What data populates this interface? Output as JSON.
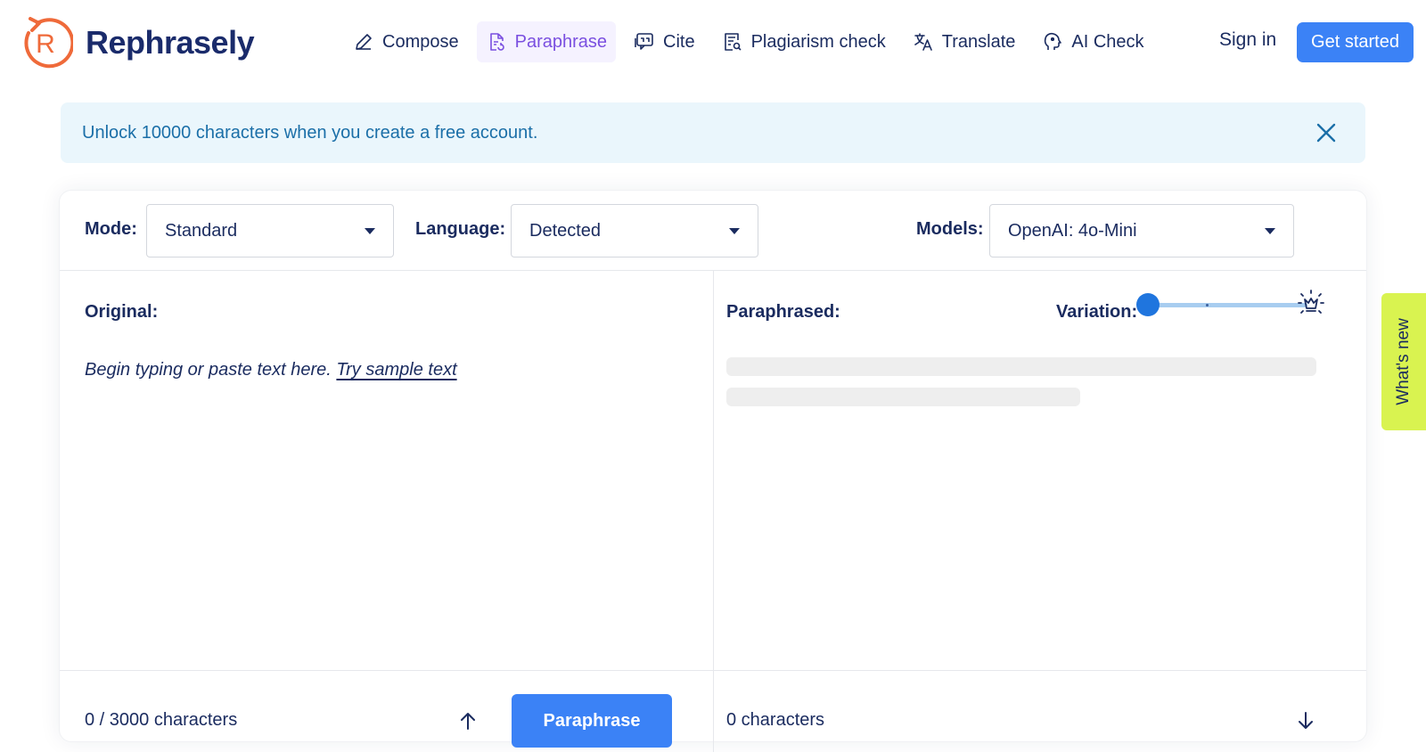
{
  "header": {
    "brand": "Rephrasely",
    "brand_color": "#ef6a3a",
    "nav": [
      {
        "label": "Compose",
        "icon": "pencil-icon"
      },
      {
        "label": "Paraphrase",
        "icon": "document-refresh-icon",
        "active": true
      },
      {
        "label": "Cite",
        "icon": "quote-bubble-icon"
      },
      {
        "label": "Plagiarism check",
        "icon": "document-search-icon"
      },
      {
        "label": "Translate",
        "icon": "translate-icon"
      },
      {
        "label": "AI Check",
        "icon": "brain-icon"
      }
    ],
    "signin": "Sign in",
    "get_started": "Get started",
    "accent": "#3b82f6"
  },
  "banner": {
    "text": "Unlock 10000 characters when you create a free account."
  },
  "toolbar": {
    "mode_label": "Mode:",
    "mode_value": "Standard",
    "language_label": "Language:",
    "language_value": "Detected",
    "models_label": "Models:",
    "models_value": "OpenAI: 4o-Mini"
  },
  "original": {
    "title": "Original:",
    "placeholder": "Begin typing or paste text here.",
    "sample_link": "Try sample text",
    "count": "0 / 3000 characters",
    "button": "Paraphrase"
  },
  "paraphrased": {
    "title": "Paraphrased:",
    "variation_label": "Variation:",
    "variation_level": 0,
    "count": "0 characters"
  },
  "whats_new": "What's new"
}
